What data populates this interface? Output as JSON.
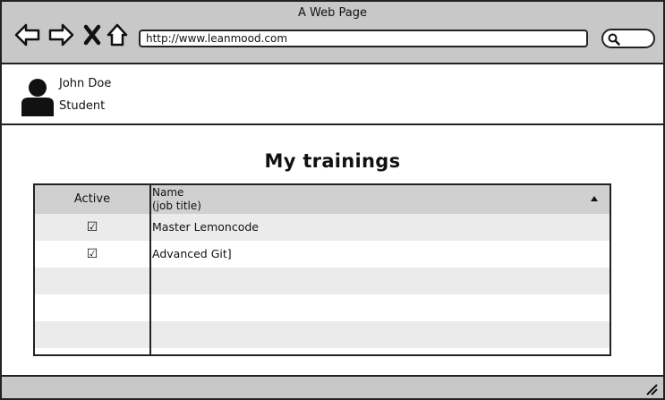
{
  "window": {
    "title": "A Web Page",
    "url": "http://www.leanmood.com"
  },
  "icons": {
    "back": "back-arrow-icon",
    "forward": "forward-arrow-icon",
    "close": "close-x-icon",
    "home": "home-icon",
    "search": "search-icon",
    "avatar": "user-avatar-icon",
    "sort": "sort-ascending-icon",
    "checkbox": "checked-checkbox-icon",
    "resize": "resize-grip-icon"
  },
  "user": {
    "name": "John Doe",
    "role": "Student"
  },
  "page": {
    "title": "My trainings"
  },
  "table": {
    "columns": {
      "active": "Active",
      "name_line1": "Name",
      "name_line2": "(job title)"
    },
    "rows": [
      {
        "active": "☑",
        "name": "Master Lemoncode"
      },
      {
        "active": "☑",
        "name": "Advanced Git]"
      }
    ]
  },
  "colors": {
    "chrome": "#c8c8c8",
    "header": "#d0d0d0",
    "row_alt": "#ebebeb",
    "border": "#222222"
  }
}
